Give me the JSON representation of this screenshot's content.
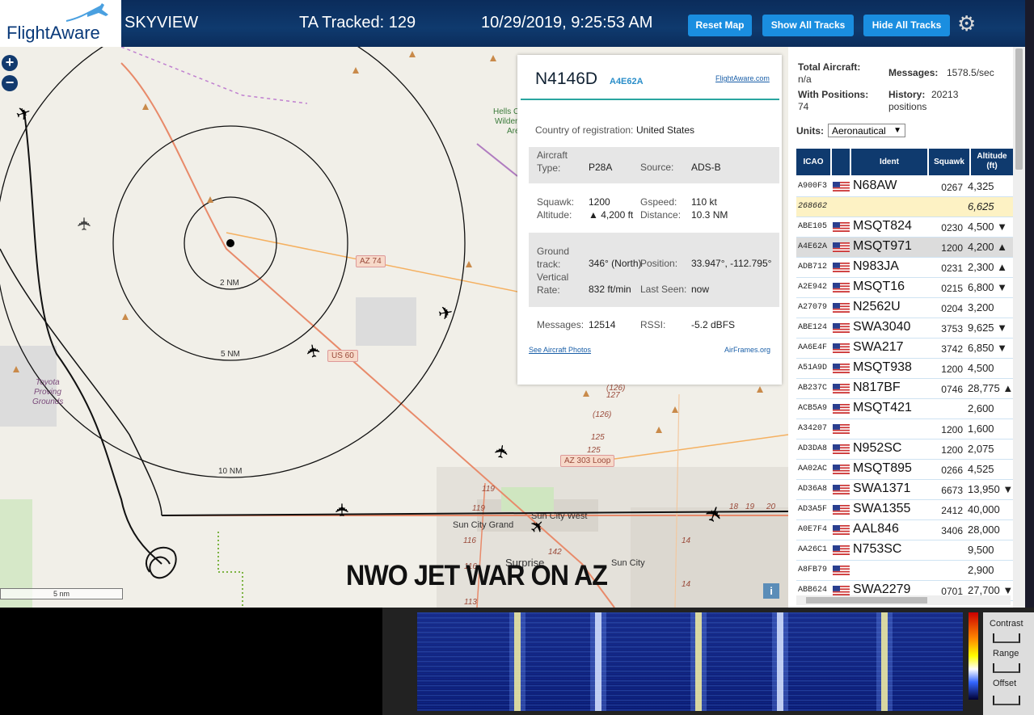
{
  "header": {
    "logo_text": "FlightAware",
    "app_name": "SKYVIEW",
    "tracked_label": "TA Tracked: 129",
    "datetime": "10/29/2019, 9:25:53 AM",
    "buttons": {
      "reset": "Reset Map",
      "show": "Show All Tracks",
      "hide": "Hide All Tracks"
    }
  },
  "map": {
    "zoom_in": "+",
    "zoom_out": "−",
    "ring_labels": [
      "2 NM",
      "5 NM",
      "10 NM"
    ],
    "route_labels": [
      "AZ 74",
      "US 60",
      "AZ 303 Loop"
    ],
    "places": [
      "Hells C",
      "Wilder",
      "Are",
      "Toyota",
      "Proving",
      "Grounds",
      "Sun City Grand",
      "Sun City West",
      "Sun City",
      "Surprise"
    ],
    "road_numbers": [
      "(126)",
      "127",
      "(126)",
      "125",
      "125",
      "119",
      "119",
      "116",
      "116",
      "142",
      "113",
      "14",
      "14",
      "18",
      "19",
      "20"
    ],
    "scale": "5 nm",
    "overlay_caption": "NWO JET WAR ON AZ",
    "info_icon": "i"
  },
  "popup": {
    "registration": "N4146D",
    "hex": "A4E62A",
    "fa_link": "FlightAware.com",
    "country_label": "Country of registration:",
    "country": "United States",
    "aircraft_type_label": "Aircraft Type:",
    "aircraft_type": "P28A",
    "source_label": "Source:",
    "source": "ADS-B",
    "squawk_label": "Squawk:",
    "squawk": "1200",
    "gspeed_label": "Gspeed:",
    "gspeed": "110 kt",
    "altitude_label": "Altitude:",
    "altitude": "▲ 4,200 ft",
    "distance_label": "Distance:",
    "distance": "10.3 NM",
    "ground_track_label": "Ground track:",
    "ground_track": "346° (North)",
    "position_label": "Position:",
    "position": "33.947°, -112.795°",
    "vrate_label": "Vertical Rate:",
    "vrate": "832 ft/min",
    "last_seen_label": "Last Seen:",
    "last_seen": "now",
    "messages_label": "Messages:",
    "messages": "12514",
    "rssi_label": "RSSI:",
    "rssi": "-5.2 dBFS",
    "photos_link": "See Aircraft Photos",
    "airframes_link": "AirFrames.org"
  },
  "sidebar": {
    "total_aircraft_label": "Total Aircraft:",
    "total_aircraft": "n/a",
    "messages_label": "Messages:",
    "messages": "1578.5/sec",
    "with_positions_label": "With Positions:",
    "with_positions": "74",
    "history_label": "History:",
    "history": "20213",
    "history_unit": "positions",
    "units_label": "Units:",
    "units_value": "Aeronautical",
    "columns": [
      "ICAO",
      "",
      "Ident",
      "Squawk",
      "Altitude (ft)"
    ],
    "rows": [
      {
        "icao": "A900F3",
        "flag": true,
        "ident": "N68AW",
        "squawk": "0267",
        "alt": "4,325",
        "state": "normal"
      },
      {
        "icao": "268662",
        "flag": false,
        "ident": "",
        "squawk": "",
        "alt": "6,625",
        "state": "mlat"
      },
      {
        "icao": "ABE105",
        "flag": true,
        "ident": "MSQT824",
        "squawk": "0230",
        "alt": "4,500 ▼",
        "state": "normal"
      },
      {
        "icao": "A4E62A",
        "flag": true,
        "ident": "MSQT971",
        "squawk": "1200",
        "alt": "4,200 ▲",
        "state": "selected"
      },
      {
        "icao": "ADB712",
        "flag": true,
        "ident": "N983JA",
        "squawk": "0231",
        "alt": "2,300 ▲",
        "state": "normal"
      },
      {
        "icao": "A2E942",
        "flag": true,
        "ident": "MSQT16",
        "squawk": "0215",
        "alt": "6,800 ▼",
        "state": "normal"
      },
      {
        "icao": "A27079",
        "flag": true,
        "ident": "N2562U",
        "squawk": "0204",
        "alt": "3,200",
        "state": "normal"
      },
      {
        "icao": "ABE124",
        "flag": true,
        "ident": "SWA3040",
        "squawk": "3753",
        "alt": "9,625 ▼",
        "state": "normal"
      },
      {
        "icao": "AA6E4F",
        "flag": true,
        "ident": "SWA217",
        "squawk": "3742",
        "alt": "6,850 ▼",
        "state": "normal"
      },
      {
        "icao": "A51A9D",
        "flag": true,
        "ident": "MSQT938",
        "squawk": "1200",
        "alt": "4,500",
        "state": "normal"
      },
      {
        "icao": "AB237C",
        "flag": true,
        "ident": "N817BF",
        "squawk": "0746",
        "alt": "28,775 ▲",
        "state": "normal"
      },
      {
        "icao": "ACB5A9",
        "flag": true,
        "ident": "MSQT421",
        "squawk": "",
        "alt": "2,600",
        "state": "normal"
      },
      {
        "icao": "A34207",
        "flag": true,
        "ident": "",
        "squawk": "1200",
        "alt": "1,600",
        "state": "normal"
      },
      {
        "icao": "AD3DA8",
        "flag": true,
        "ident": "N952SC",
        "squawk": "1200",
        "alt": "2,075",
        "state": "normal"
      },
      {
        "icao": "AA02AC",
        "flag": true,
        "ident": "MSQT895",
        "squawk": "0266",
        "alt": "4,525",
        "state": "normal"
      },
      {
        "icao": "AD36A8",
        "flag": true,
        "ident": "SWA1371",
        "squawk": "6673",
        "alt": "13,950 ▼",
        "state": "normal"
      },
      {
        "icao": "AD3A5F",
        "flag": true,
        "ident": "SWA1355",
        "squawk": "2412",
        "alt": "40,000",
        "state": "normal"
      },
      {
        "icao": "A0E7F4",
        "flag": true,
        "ident": "AAL846",
        "squawk": "3406",
        "alt": "28,000",
        "state": "normal"
      },
      {
        "icao": "AA26C1",
        "flag": true,
        "ident": "N753SC",
        "squawk": "",
        "alt": "9,500",
        "state": "normal"
      },
      {
        "icao": "A8FB79",
        "flag": true,
        "ident": "",
        "squawk": "",
        "alt": "2,900",
        "state": "normal"
      },
      {
        "icao": "ABB624",
        "flag": true,
        "ident": "SWA2279",
        "squawk": "0701",
        "alt": "27,700 ▼",
        "state": "normal"
      }
    ]
  },
  "spectrum": {
    "contrast_label": "Contrast",
    "range_label": "Range",
    "offset_label": "Offset"
  },
  "colors": {
    "header_bg": "#0f3a6e",
    "button_bg": "#1a8ee0",
    "selected_row": "#dcdcdc",
    "mlat_row": "#fdf2c4",
    "row_bg": "#ffffff"
  }
}
